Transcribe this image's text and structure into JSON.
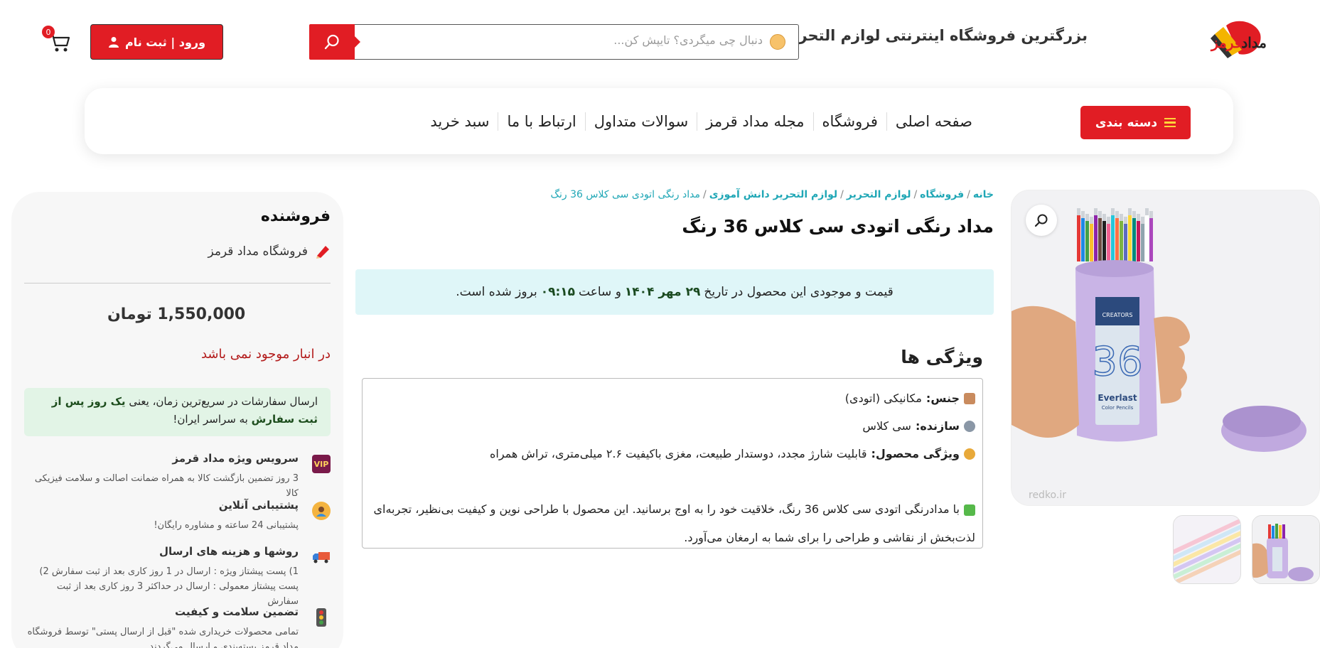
{
  "header": {
    "logo_text_a": "مداد",
    "logo_text_b": "قرمز",
    "tagline": "بزرگترین فروشگاه اینترنتی لوازم التحریر",
    "search_placeholder": "دنبال چی میگردی؟ تایپش کن...",
    "login_label": "ورود | ثبت نام",
    "cart_count": "0"
  },
  "nav": {
    "category_label": "دسته بندی",
    "links": [
      "صفحه اصلی",
      "فروشگاه",
      "مجله مداد قرمز",
      "سوالات متداول",
      "ارتباط با ما",
      "سبد خرید"
    ]
  },
  "gallery": {
    "watermark": "redko.ir",
    "brand_label": "Everlast",
    "brand_sub": "Color Pencils",
    "box_number": "36",
    "maker_label": "CREATORS"
  },
  "breadcrumb": {
    "items": [
      "خانه",
      "فروشگاه",
      "لوازم التحریر",
      "لوازم التحریر دانش آموزی"
    ],
    "current": "مداد رنگی اتودی سی کلاس 36 رنگ"
  },
  "product": {
    "title": "مداد رنگی اتودی سی کلاس 36 رنگ",
    "update_before": "قیمت و موجودی این محصول در تاریخ",
    "update_date": "۲۹ مهر ۱۴۰۴",
    "update_mid": "و ساعت",
    "update_time": "۰۹:۱۵",
    "update_after": "بروز شده است."
  },
  "features": {
    "title": "ویژگی ها",
    "rows": [
      {
        "label": "جنس:",
        "value": "مکانیکی (اتودی)"
      },
      {
        "label": "سازنده:",
        "value": "سی کلاس"
      },
      {
        "label": "ویژگی محصول:",
        "value": "قابلیت شارژ مجدد، دوستدار طبیعت، مغزی باکیفیت ۲.۶ میلی‌متری، تراش همراه"
      }
    ],
    "description": "با مدادرنگی اتودی سی کلاس 36 رنگ، خلاقیت خود را به اوج برسانید. این محصول با طراحی نوین و کیفیت بی‌نظیر، تجربه‌ای لذت‌بخش از نقاشی و طراحی را برای شما به ارمغان می‌آورد."
  },
  "sidebar": {
    "title": "فروشنده",
    "seller_name": "فروشگاه مداد قرمز",
    "price": "1,550,000 تومان",
    "stock": "در انبار موجود نمی باشد",
    "ship_a": "ارسال سفارشات در سریع‌ترین زمان، یعنی",
    "ship_b": "یک روز پس از ثبت سفارش",
    "ship_c": "به سراسر ایران!",
    "services": [
      {
        "icon": "VIP",
        "title": "سرویس ویژه مداد قرمز",
        "desc": "3 روز تضمین بازگشت کالا به همراه ضمانت اصالت و سلامت فیزیکی کالا"
      },
      {
        "icon": "",
        "title": "پشتیبانی آنلاین",
        "desc": "پشتیبانی 24 ساعته و مشاوره رایگان!"
      },
      {
        "icon": "",
        "title": "روشها و هزینه های ارسال",
        "desc": "1) پست پیشتاز ویژه : ارسال در 1 روز کاری بعد از ثبت سفارش 2) پست پیشتاز معمولی : ارسال در حداکثر 3 روز کاری بعد از ثبت سفارش"
      },
      {
        "icon": "",
        "title": "تضمین سلامت و کیفیت",
        "desc": "تمامی محصولات خریداری شده \"قبل از ارسال پستی\" توسط فروشگاه مداد قرمز بسته‌بندی و ارسال می‌گردند."
      }
    ]
  },
  "colors": {
    "brand_red": "#e11d24",
    "teal": "#20a7b6",
    "update_bg": "#dff6f8",
    "ship_bg": "#e2f4e6",
    "box_lavender": "#c9b4e6"
  }
}
